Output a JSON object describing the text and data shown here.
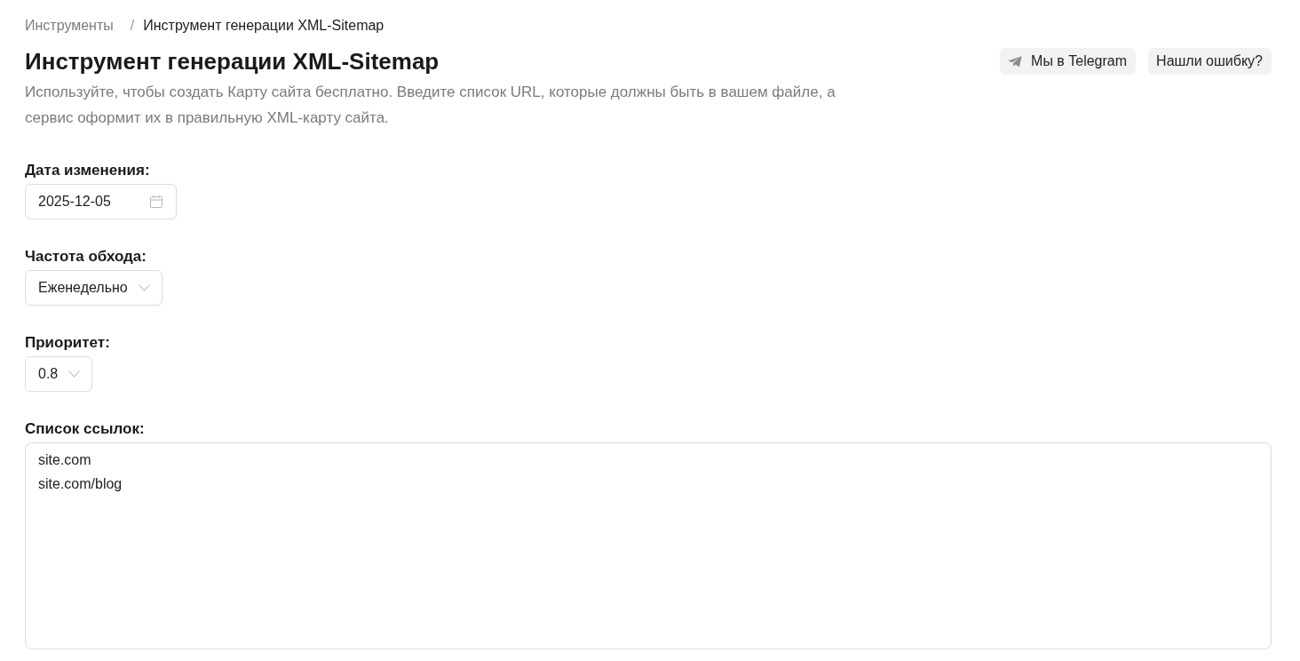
{
  "breadcrumb": {
    "separator": "/",
    "items": [
      {
        "label": "Инструменты",
        "current": false
      },
      {
        "label": "Инструмент генерации XML-Sitemap",
        "current": true
      }
    ]
  },
  "header": {
    "title": "Инструмент генерации XML-Sitemap",
    "description": "Используйте, чтобы создать Карту сайта бесплатно. Введите список URL, которые должны быть в вашем файле, а сервис оформит их в правильную XML-карту сайта.",
    "actions": [
      {
        "kind": "iconed",
        "label": "Мы в Telegram"
      },
      {
        "kind": "plain",
        "label": "Нашли ошибку?"
      }
    ]
  },
  "fields": [
    {
      "kind": "date",
      "label": "Дата изменения:",
      "value": "2025-12-05"
    },
    {
      "kind": "select",
      "label": "Частота обхода:",
      "value": "Еженедельно"
    },
    {
      "kind": "select",
      "label": "Приоритет:",
      "value": "0.8"
    },
    {
      "kind": "textarea",
      "label": "Список ссылок:",
      "lines": [
        "site.com",
        "site.com/blog"
      ]
    }
  ]
}
